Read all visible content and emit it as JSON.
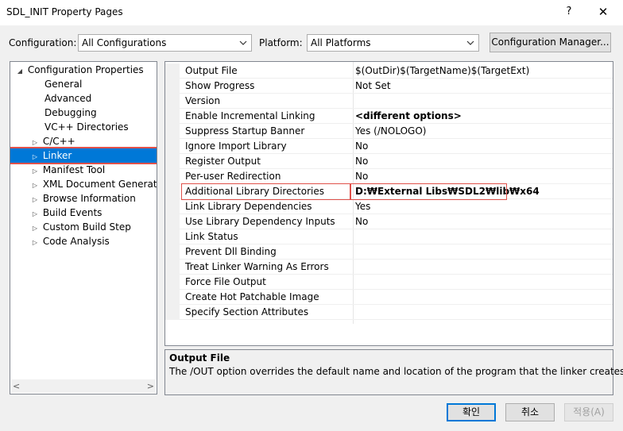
{
  "window": {
    "title": "SDL_INIT Property Pages",
    "help_glyph": "?",
    "close_glyph": "✕"
  },
  "toolbar": {
    "configuration_label": "Configuration:",
    "configuration_value": "All Configurations",
    "platform_label": "Platform:",
    "platform_value": "All Platforms",
    "config_manager_label": "Configuration Manager..."
  },
  "tree": {
    "root": "Configuration Properties",
    "items": [
      {
        "label": "General",
        "expandable": false
      },
      {
        "label": "Advanced",
        "expandable": false
      },
      {
        "label": "Debugging",
        "expandable": false
      },
      {
        "label": "VC++ Directories",
        "expandable": false
      },
      {
        "label": "C/C++",
        "expandable": true
      },
      {
        "label": "Linker",
        "expandable": true,
        "selected": true
      },
      {
        "label": "Manifest Tool",
        "expandable": true
      },
      {
        "label": "XML Document Generator",
        "expandable": true
      },
      {
        "label": "Browse Information",
        "expandable": true
      },
      {
        "label": "Build Events",
        "expandable": true
      },
      {
        "label": "Custom Build Step",
        "expandable": true
      },
      {
        "label": "Code Analysis",
        "expandable": true
      }
    ]
  },
  "properties": [
    {
      "name": "Output File",
      "value": "$(OutDir)$(TargetName)$(TargetExt)"
    },
    {
      "name": "Show Progress",
      "value": "Not Set"
    },
    {
      "name": "Version",
      "value": ""
    },
    {
      "name": "Enable Incremental Linking",
      "value": "<different options>",
      "bold": true
    },
    {
      "name": "Suppress Startup Banner",
      "value": "Yes (/NOLOGO)"
    },
    {
      "name": "Ignore Import Library",
      "value": "No"
    },
    {
      "name": "Register Output",
      "value": "No"
    },
    {
      "name": "Per-user Redirection",
      "value": "No"
    },
    {
      "name": "Additional Library Directories",
      "value": "D:₩External Libs₩SDL2₩lib₩x64",
      "bold": true,
      "highlighted": true
    },
    {
      "name": "Link Library Dependencies",
      "value": "Yes"
    },
    {
      "name": "Use Library Dependency Inputs",
      "value": "No"
    },
    {
      "name": "Link Status",
      "value": ""
    },
    {
      "name": "Prevent Dll Binding",
      "value": ""
    },
    {
      "name": "Treat Linker Warning As Errors",
      "value": ""
    },
    {
      "name": "Force File Output",
      "value": ""
    },
    {
      "name": "Create Hot Patchable Image",
      "value": ""
    },
    {
      "name": "Specify Section Attributes",
      "value": ""
    }
  ],
  "description": {
    "title": "Output File",
    "text": "The /OUT option overrides the default name and location of the program that the linker creates."
  },
  "buttons": {
    "ok": "확인",
    "cancel": "취소",
    "apply": "적용(A)"
  },
  "colors": {
    "selection": "#0078d7",
    "highlight_border": "#e0514b"
  }
}
